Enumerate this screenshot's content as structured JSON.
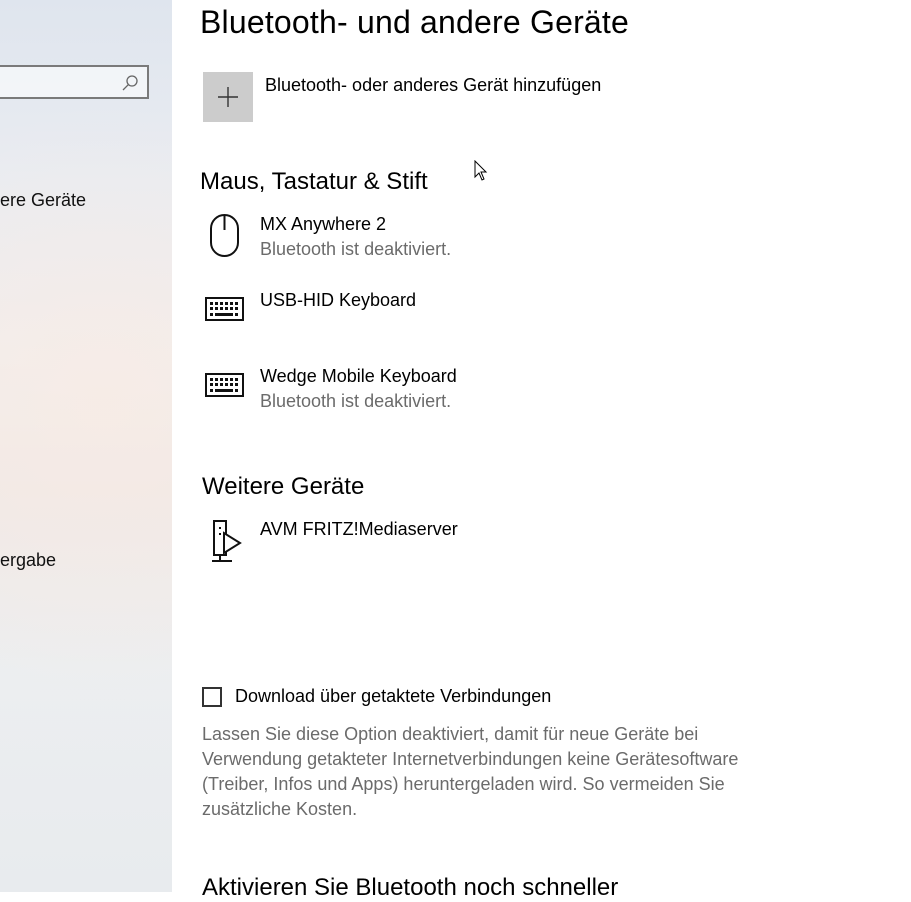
{
  "sidebar": {
    "search_placeholder": "",
    "items": [
      {
        "label": "ere Geräte"
      },
      {
        "label": "ergabe"
      }
    ]
  },
  "main": {
    "title": "Bluetooth- und andere Geräte",
    "add_device_label": "Bluetooth- oder anderes Gerät hinzufügen",
    "sections": [
      {
        "title": "Maus, Tastatur & Stift",
        "devices": [
          {
            "name": "MX Anywhere 2",
            "status": "Bluetooth ist deaktiviert.",
            "icon": "mouse-icon"
          },
          {
            "name": "USB-HID Keyboard",
            "status": "",
            "icon": "keyboard-icon"
          },
          {
            "name": "Wedge Mobile Keyboard",
            "status": "Bluetooth ist deaktiviert.",
            "icon": "keyboard-icon"
          }
        ]
      },
      {
        "title": "Weitere Geräte",
        "devices": [
          {
            "name": "AVM FRITZ!Mediaserver",
            "status": "",
            "icon": "media-server-icon"
          }
        ]
      }
    ],
    "metered_download": {
      "label": "Download über getaktete Verbindungen",
      "checked": false,
      "description": "Lassen Sie diese Option deaktiviert, damit für neue Geräte bei Verwendung getakteter Internetverbindungen keine Gerätesoftware (Treiber, Infos und Apps) heruntergeladen wird. So vermeiden Sie zusätzliche Kosten."
    },
    "bottom_section_title": "Aktivieren Sie Bluetooth noch schneller"
  },
  "colors": {
    "accent_tile": "#cccccc",
    "secondary_text": "#6b6b6b"
  }
}
